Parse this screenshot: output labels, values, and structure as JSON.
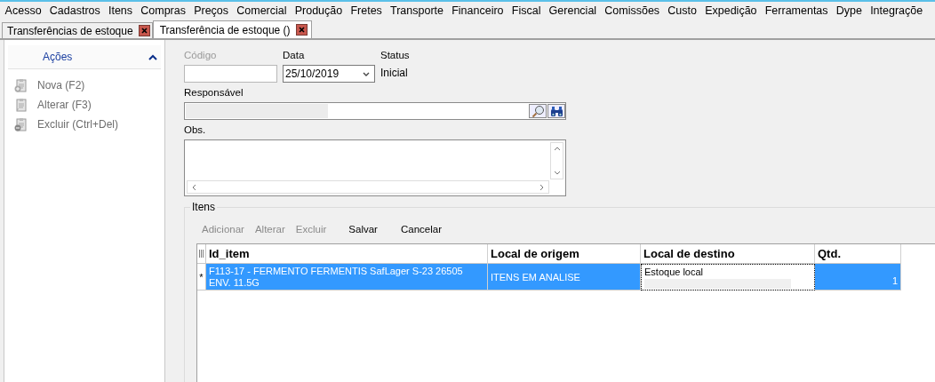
{
  "menu": [
    "Acesso",
    "Cadastros",
    "Itens",
    "Compras",
    "Preços",
    "Comercial",
    "Produção",
    "Fretes",
    "Transporte",
    "Financeiro",
    "Fiscal",
    "Gerencial",
    "Comissões",
    "Custo",
    "Expedição",
    "Ferramentas",
    "Dype",
    "Integraçõe"
  ],
  "tabs": [
    {
      "label": "Transferências de estoque",
      "selected": false
    },
    {
      "label": "Transferência de estoque ()",
      "selected": true
    }
  ],
  "sidebar": {
    "title": "Ações",
    "expanded": true,
    "items": [
      {
        "label": "Nova (F2)",
        "kind": "new",
        "disabled": true
      },
      {
        "label": "Alterar (F3)",
        "kind": "edit",
        "disabled": true
      },
      {
        "label": "Excluir (Ctrl+Del)",
        "kind": "delete",
        "disabled": true
      }
    ]
  },
  "form": {
    "codigo": {
      "label": "Código",
      "disabled": true
    },
    "data": {
      "label": "Data",
      "value": "25/10/2019"
    },
    "status": {
      "label": "Status",
      "value": "Inicial"
    },
    "responsavel": {
      "label": "Responsável"
    },
    "obs": {
      "label": "Obs."
    }
  },
  "itens": {
    "title": "Itens",
    "toolbar": [
      {
        "label": "Adicionar",
        "disabled": true
      },
      {
        "label": "Alterar",
        "disabled": true
      },
      {
        "label": "Excluir",
        "disabled": true
      },
      {
        "label": "Salvar",
        "disabled": false
      },
      {
        "label": "Cancelar",
        "disabled": false
      }
    ],
    "columns": [
      "Id_item",
      "Local de origem",
      "Local de destino",
      "Qtd."
    ],
    "rows": [
      {
        "indicator": "*",
        "selected": true,
        "cells": [
          {
            "text": "F113-17 - FERMENTO FERMENTIS SafLager S-23 26505 ENV. 11.5G",
            "kind": "text"
          },
          {
            "text": "ITENS EM ANALISE",
            "kind": "text"
          },
          {
            "text": "Estoque local",
            "kind": "editor"
          },
          {
            "text": "1",
            "kind": "number"
          }
        ]
      }
    ]
  }
}
